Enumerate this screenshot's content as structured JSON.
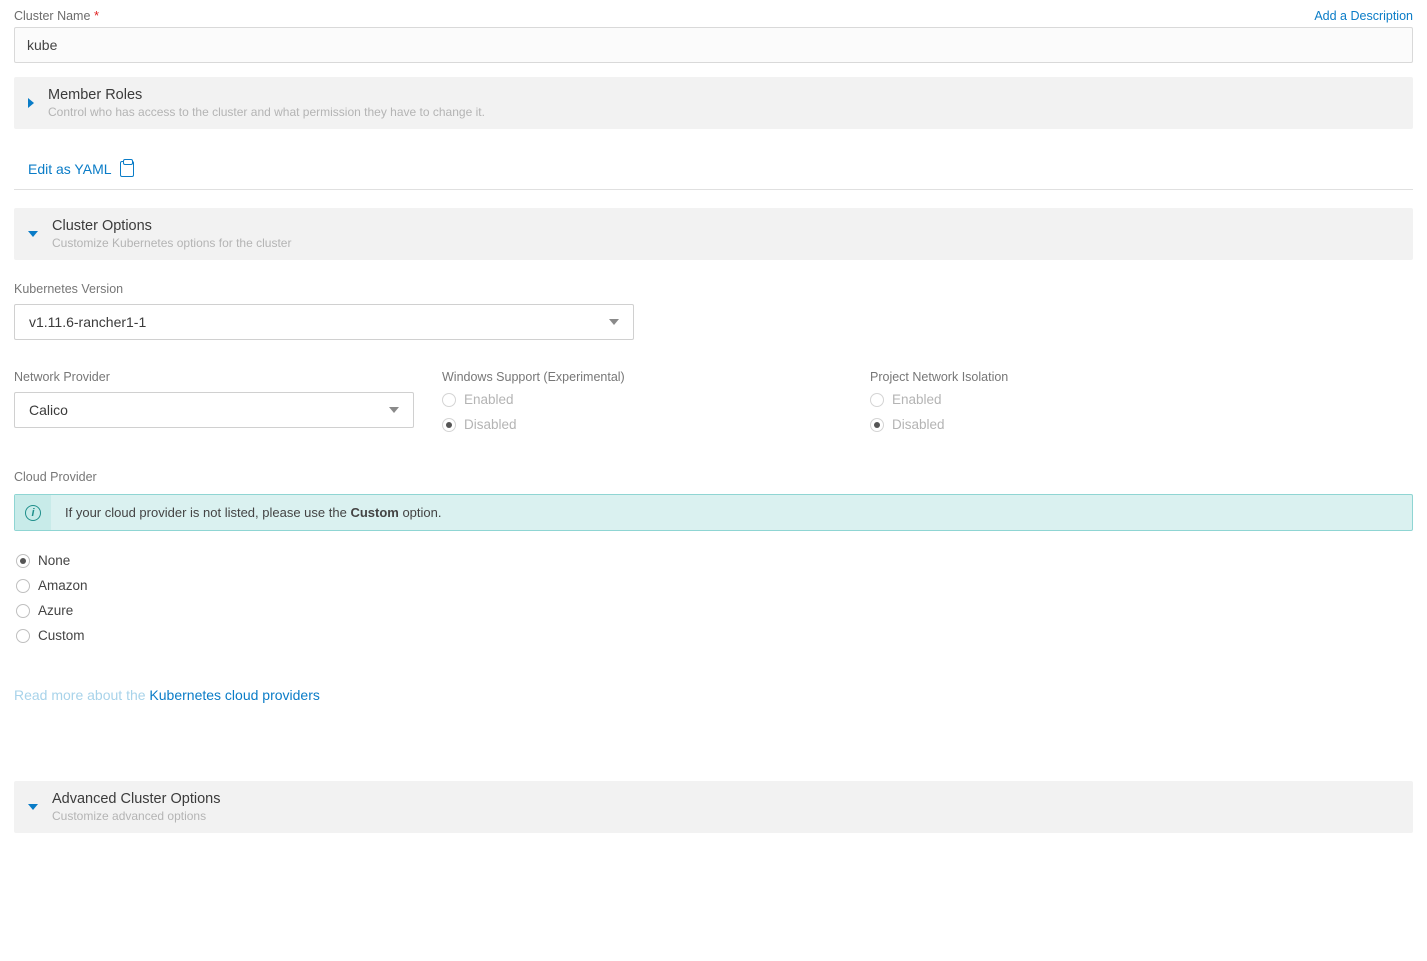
{
  "clusterName": {
    "label": "Cluster Name",
    "value": "kube",
    "addDescription": "Add a Description"
  },
  "memberRoles": {
    "title": "Member Roles",
    "subtitle": "Control who has access to the cluster and what permission they have to change it."
  },
  "editYaml": "Edit as YAML",
  "clusterOptions": {
    "title": "Cluster Options",
    "subtitle": "Customize Kubernetes options for the cluster"
  },
  "k8sVersion": {
    "label": "Kubernetes Version",
    "value": "v1.11.6-rancher1-1"
  },
  "networkProvider": {
    "label": "Network Provider",
    "value": "Calico"
  },
  "windowsSupport": {
    "label": "Windows Support (Experimental)",
    "options": {
      "enabled": "Enabled",
      "disabled": "Disabled"
    },
    "selected": "disabled",
    "locked": true
  },
  "projectIsolation": {
    "label": "Project Network Isolation",
    "options": {
      "enabled": "Enabled",
      "disabled": "Disabled"
    },
    "selected": "disabled",
    "locked": true
  },
  "cloudProvider": {
    "label": "Cloud Provider",
    "info_prefix": "If your cloud provider is not listed, please use the ",
    "info_bold": "Custom",
    "info_suffix": " option.",
    "options": {
      "none": "None",
      "amazon": "Amazon",
      "azure": "Azure",
      "custom": "Custom"
    },
    "selected": "none",
    "readMore_prefix": "Read more about the ",
    "readMore_link": "Kubernetes cloud providers"
  },
  "advanced": {
    "title": "Advanced Cluster Options",
    "subtitle": "Customize advanced options"
  }
}
